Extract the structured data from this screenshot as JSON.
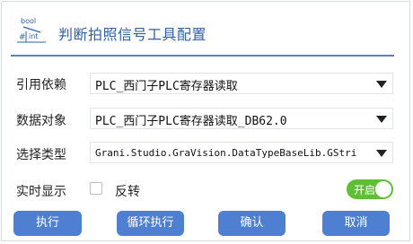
{
  "dialog": {
    "title": "判断拍照信号工具配置",
    "icon_text_top": "bool",
    "icon_text_bottom": "int"
  },
  "fields": [
    {
      "label": "引用依赖",
      "value": "PLC_西门子PLC寄存器读取"
    },
    {
      "label": "数据对象",
      "value": "PLC_西门子PLC寄存器读取_DB62.0"
    },
    {
      "label": "选择类型",
      "value": "Grani.Studio.GraVision.DataTypeBaseLib.GStri"
    }
  ],
  "realtime": {
    "label": "实时显示",
    "invert_label": "反转",
    "invert_checked": false,
    "toggle_label": "开启",
    "toggle_on": true
  },
  "buttons": {
    "execute": "执行",
    "loop_execute": "循环执行",
    "confirm": "确认",
    "cancel": "取消"
  },
  "colors": {
    "accent": "#4f7fd0",
    "title": "#2f5fa8",
    "toggle_on": "#5fbf34"
  }
}
